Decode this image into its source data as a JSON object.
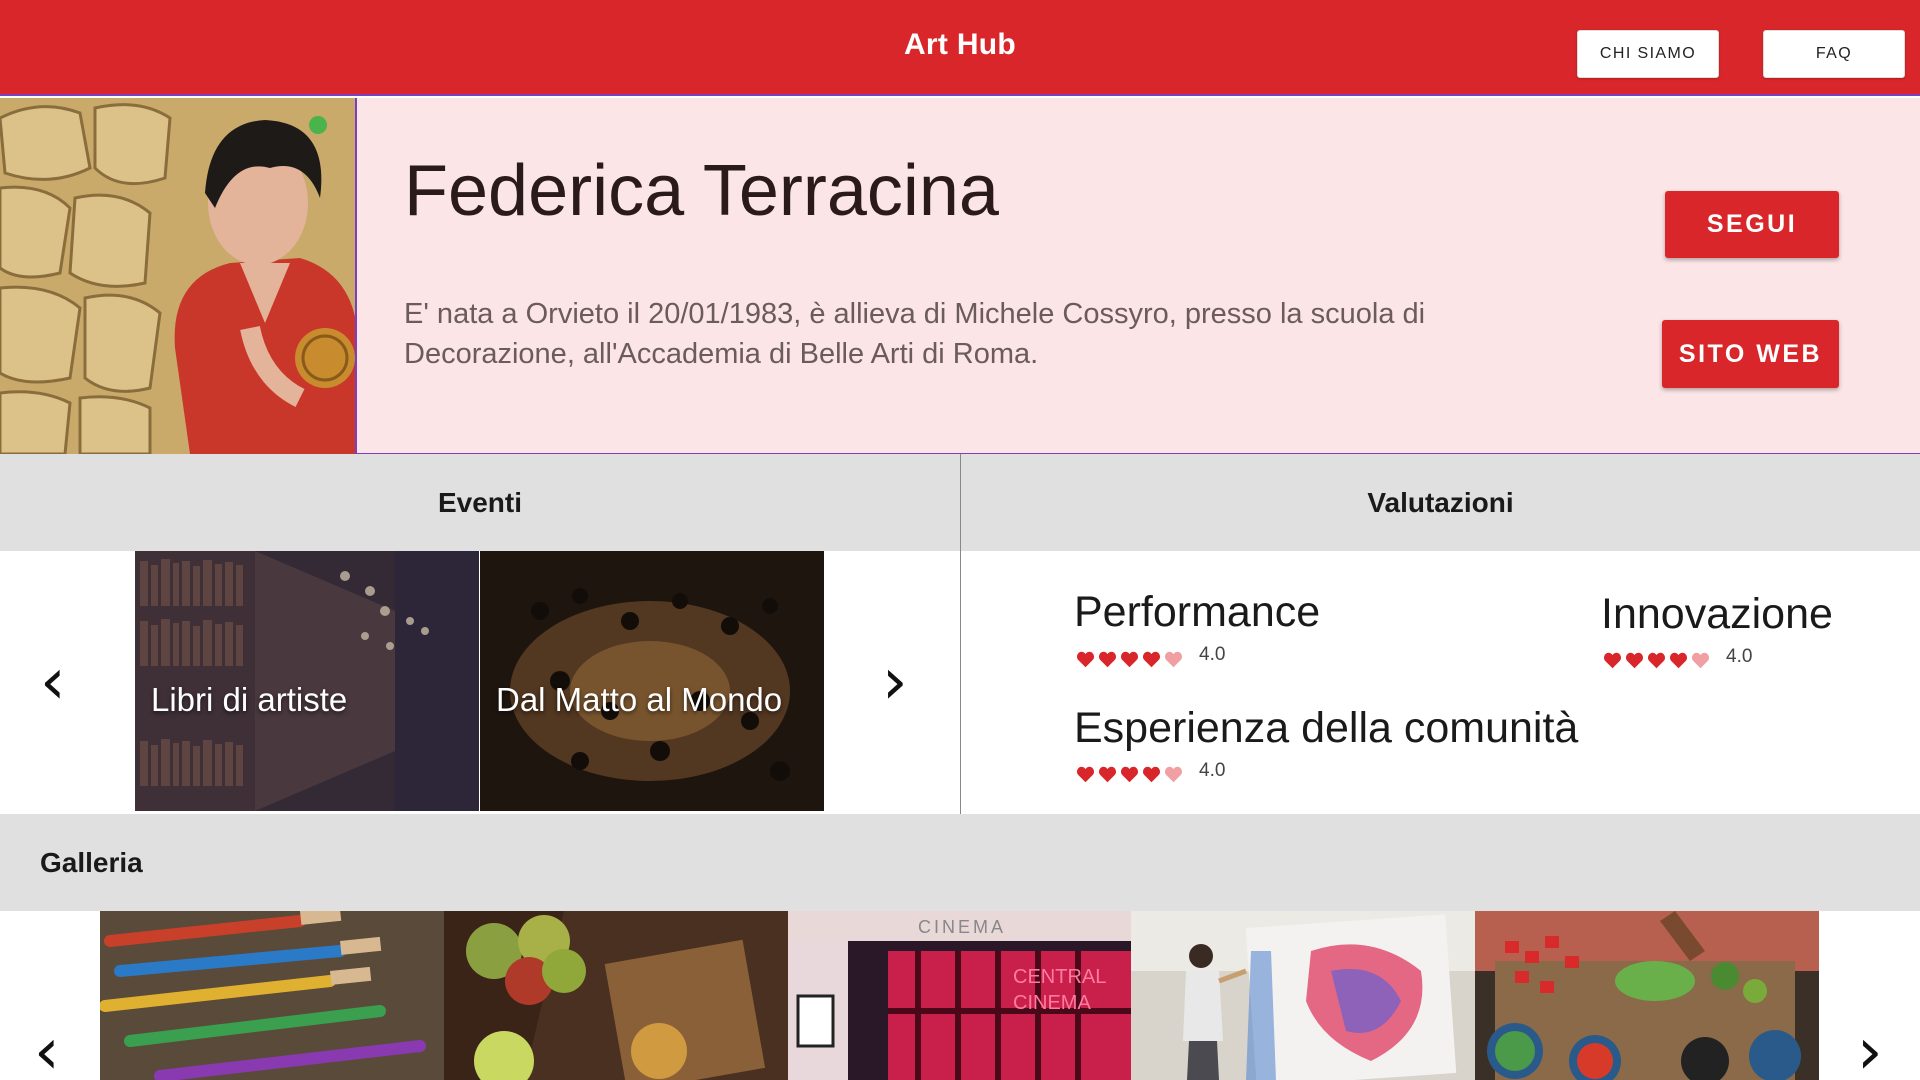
{
  "header": {
    "title": "Art Hub",
    "nav": {
      "about": "CHI SIAMO",
      "faq": "FAQ"
    }
  },
  "profile": {
    "name": "Federica Terracina",
    "bio": "E' nata a Orvieto il 20/01/1983, è allieva di Michele Cossyro, presso la scuola di Decorazione, all'Accademia di Belle Arti di Roma.",
    "follow_label": "SEGUI",
    "website_label": "SITO WEB"
  },
  "events": {
    "title": "Eventi",
    "items": [
      {
        "label": "Libri di artiste"
      },
      {
        "label": "Dal Matto al Mondo"
      }
    ]
  },
  "ratings": {
    "title": "Valutazioni",
    "items": [
      {
        "label": "Performance",
        "value": "4.0",
        "score": 4,
        "max": 5
      },
      {
        "label": "Innovazione",
        "value": "4.0",
        "score": 4,
        "max": 5
      },
      {
        "label": "Esperienza della comunità",
        "value": "4.0",
        "score": 4,
        "max": 5
      }
    ]
  },
  "gallery": {
    "title": "Galleria",
    "images": [
      "paint-brushes",
      "apples-kitchen",
      "central-cinema",
      "painter-canvas",
      "cooking-vegetables"
    ]
  },
  "colors": {
    "accent": "#d8262a",
    "profile_bg": "#fbe5e6",
    "section_bg": "#e0e0e0",
    "heart_full": "#d8262a",
    "heart_empty": "#f0a0a2"
  }
}
